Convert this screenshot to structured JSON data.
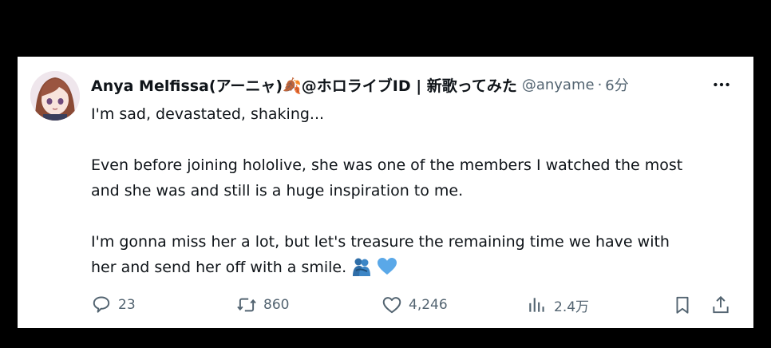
{
  "tweet": {
    "display_name": "Anya Melfissa(アーニャ)🍂@ホロライブID | 新歌ってみた",
    "handle": "@anyame",
    "separator": "·",
    "time": "6分",
    "lines": [
      "I'm sad, devastated, shaking...",
      "",
      "Even before joining hololive, she was one of the members I watched the most",
      "and she was and still is a huge inspiration to me.",
      "",
      "I'm gonna miss her a lot, but let's treasure the remaining time we have with",
      "her and send her off with a smile."
    ],
    "emojis": [
      "people-hugging",
      "blue-heart"
    ]
  },
  "actions": {
    "reply_count": "23",
    "retweet_count": "860",
    "like_count": "4,246",
    "views_count": "2.4万"
  },
  "colors": {
    "text": "#0f1419",
    "secondary": "#536471",
    "heart_blue": "#5aa8e8",
    "background": "#000000",
    "card": "#ffffff"
  },
  "icons": [
    "avatar",
    "more-icon",
    "reply-icon",
    "retweet-icon",
    "like-icon",
    "views-icon",
    "bookmark-icon",
    "share-icon"
  ]
}
